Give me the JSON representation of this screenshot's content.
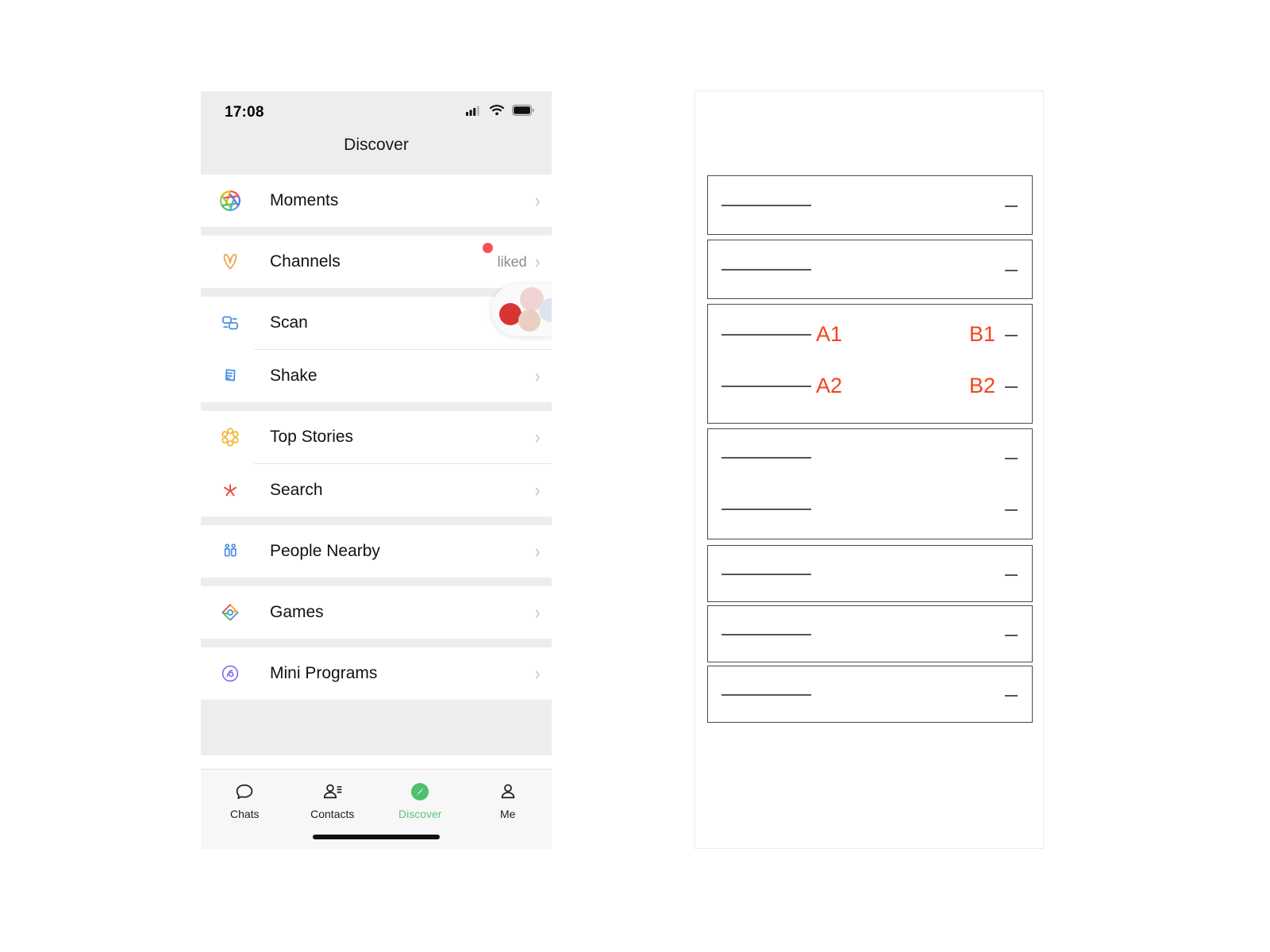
{
  "phone": {
    "status_bar": {
      "time": "17:08",
      "icons": [
        "cellular-signal-icon",
        "wifi-icon",
        "battery-icon"
      ]
    },
    "nav": {
      "title": "Discover"
    },
    "rows": [
      {
        "label": "Moments",
        "icon": "moments-aperture-icon",
        "accessory": "chevron-right-icon"
      },
      {
        "label": "Channels",
        "icon": "channels-icon",
        "accessory": "chevron-right-icon",
        "thumb": true,
        "badge": true,
        "detail": "liked"
      },
      {
        "label": "Scan",
        "icon": "scan-icon",
        "accessory": "chevron-right-icon"
      },
      {
        "label": "Shake",
        "icon": "shake-icon",
        "accessory": "chevron-right-icon"
      },
      {
        "label": "Top Stories",
        "icon": "top-stories-icon",
        "accessory": "chevron-right-icon"
      },
      {
        "label": "Search",
        "icon": "search-sparkle-icon",
        "accessory": "chevron-right-icon"
      },
      {
        "label": "People Nearby",
        "icon": "people-nearby-icon",
        "accessory": "chevron-right-icon"
      },
      {
        "label": "Games",
        "icon": "games-icon",
        "accessory": "chevron-right-icon"
      },
      {
        "label": "Mini Programs",
        "icon": "mini-programs-icon",
        "accessory": "chevron-right-icon"
      }
    ],
    "tabs": [
      {
        "label": "Chats",
        "icon": "chat-bubble-icon",
        "active": false
      },
      {
        "label": "Contacts",
        "icon": "contacts-icon",
        "active": false
      },
      {
        "label": "Discover",
        "icon": "compass-icon",
        "active": true
      },
      {
        "label": "Me",
        "icon": "person-icon",
        "active": false
      }
    ],
    "colors": {
      "active_tab": "#5ac57c",
      "badge": "#fa5151",
      "status_bg": "#ededed"
    }
  },
  "wireframe": {
    "annotation_color": "#f4431c",
    "boxes": [
      {
        "lines": 1,
        "tags": []
      },
      {
        "lines": 1,
        "tags": []
      },
      {
        "lines": 2,
        "tags": [
          "A1",
          "B1",
          "A2",
          "B2"
        ]
      },
      {
        "lines": 2,
        "tags": []
      },
      {
        "lines": 1,
        "tags": []
      },
      {
        "lines": 1,
        "tags": []
      },
      {
        "lines": 1,
        "tags": []
      }
    ],
    "labels": {
      "a1": "A1",
      "b1": "B1",
      "a2": "A2",
      "b2": "B2"
    }
  }
}
